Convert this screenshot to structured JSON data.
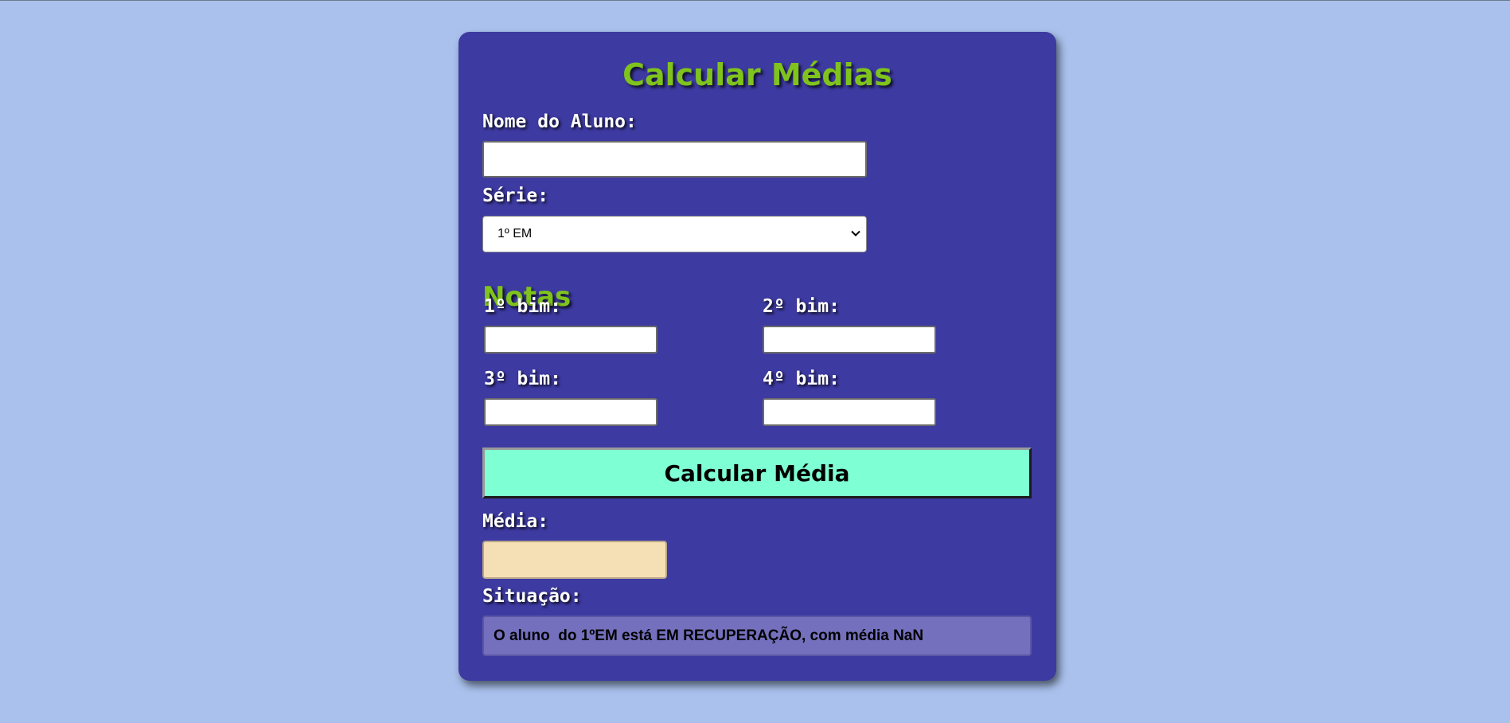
{
  "form": {
    "title": "Calcular Médias",
    "nome_label": "Nome do Aluno:",
    "nome_value": "",
    "serie_label": "Série:",
    "serie_selected": "1º EM",
    "notas_heading": "Notas",
    "grades": [
      {
        "label": "1º bim:",
        "value": ""
      },
      {
        "label": "2º bim:",
        "value": ""
      },
      {
        "label": "3º bim:",
        "value": ""
      },
      {
        "label": "4º bim:",
        "value": ""
      }
    ],
    "button_label": "Calcular Média",
    "media_label": "Média:",
    "media_value": "",
    "situacao_label": "Situação:",
    "situacao_text": "O aluno  do 1ºEM está EM RECUPERAÇÃO, com média NaN"
  },
  "colors": {
    "background": "#a9c1ec",
    "card": "#3d3aa1",
    "title_green": "#7fc31c",
    "button": "#7fffd4",
    "media_output": "#f5dfb4",
    "situacao_box": "#7470bd"
  }
}
